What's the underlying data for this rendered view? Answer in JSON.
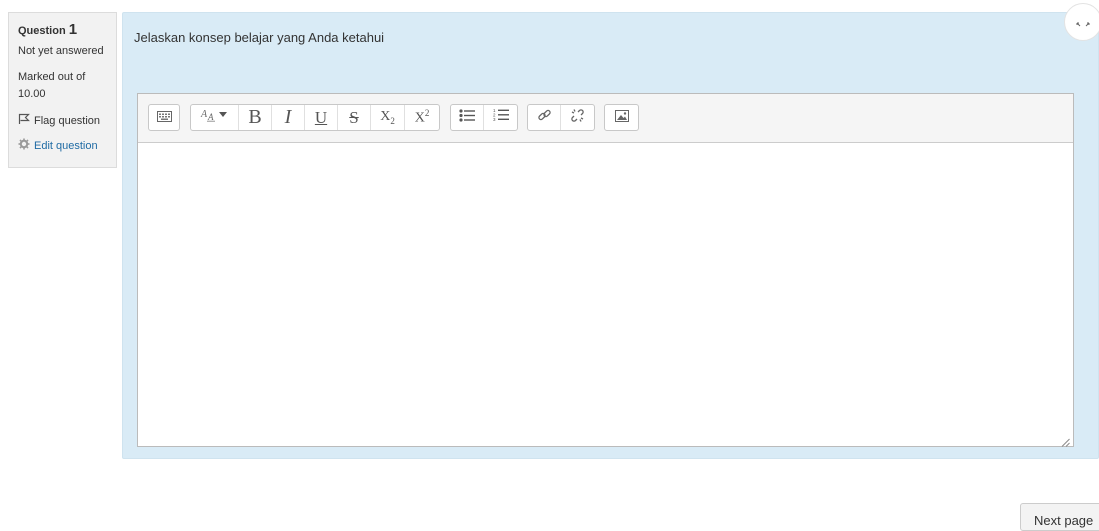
{
  "info": {
    "question_label": "Question",
    "question_number": "1",
    "state": "Not yet answered",
    "grade": "Marked out of 10.00",
    "flag_label": "Flag question",
    "edit_label": "Edit question"
  },
  "question": {
    "text": "Jelaskan konsep belajar yang Anda ketahui"
  },
  "editor": {
    "toolbar_icons": [
      "toolbar-toggle-icon",
      "font-style-icon",
      "bold-icon",
      "italic-icon",
      "underline-icon",
      "strikethrough-icon",
      "subscript-icon",
      "superscript-icon",
      "unordered-list-icon",
      "ordered-list-icon",
      "link-icon",
      "unlink-icon",
      "image-icon"
    ],
    "bold": "B",
    "italic": "I",
    "underline": "U",
    "strike": "S",
    "subscript": "X",
    "subscript_sub": "2",
    "superscript": "X",
    "superscript_sup": "2",
    "content": ""
  },
  "navigation": {
    "next_label": "Next page"
  }
}
